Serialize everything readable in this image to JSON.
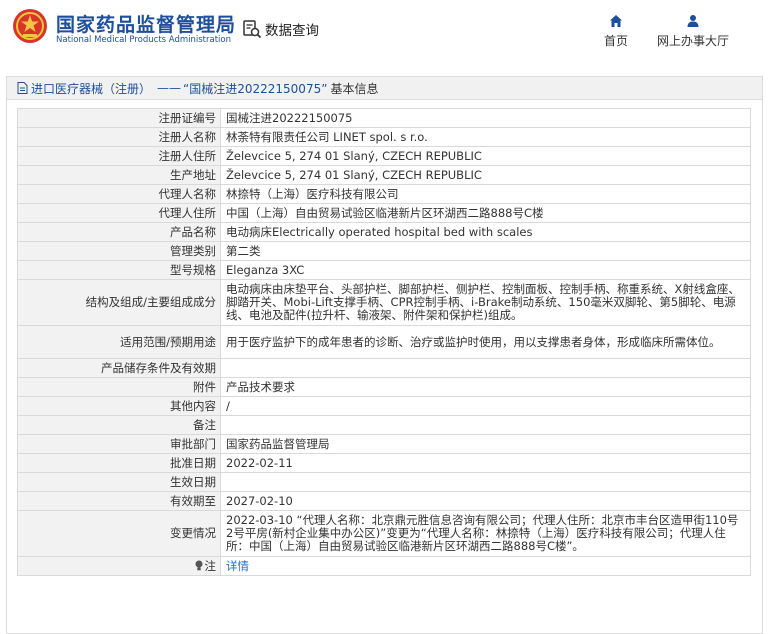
{
  "header": {
    "org_cn": "国家药品监督管理局",
    "org_en": "National Medical Products Administration",
    "query_label": "数据查询",
    "nav": [
      {
        "label": "首页",
        "icon": "home-icon"
      },
      {
        "label": "网上办事大厅",
        "icon": "user-icon"
      }
    ]
  },
  "breadcrumb": {
    "part1": "进口医疗器械（注册）",
    "sep": "——",
    "part2": "“国械注进20222150075”",
    "part3": "基本信息"
  },
  "rows": [
    {
      "label": "注册证编号",
      "value": "国械注进20222150075"
    },
    {
      "label": "注册人名称",
      "value": "林荼特有限责任公司 LINET spol. s r.o."
    },
    {
      "label": "注册人住所",
      "value": "Želevcice 5, 274 01 Slaný, CZECH REPUBLIC"
    },
    {
      "label": "生产地址",
      "value": "Želevcice 5, 274 01 Slaný, CZECH REPUBLIC"
    },
    {
      "label": "代理人名称",
      "value": "林捺特（上海）医疗科技有限公司"
    },
    {
      "label": "代理人住所",
      "value": "中国（上海）自由贸易试验区临港新片区环湖西二路888号C楼"
    },
    {
      "label": "产品名称",
      "value": "电动病床Electrically operated hospital bed with scales"
    },
    {
      "label": "管理类别",
      "value": "第二类"
    },
    {
      "label": "型号规格",
      "value": "Eleganza 3XC"
    },
    {
      "label": "结构及组成/主要组成成分",
      "value": "电动病床由床垫平台、头部护栏、脚部护栏、侧护栏、控制面板、控制手柄、称重系统、X射线盒座、脚踏开关、Mobi-Lift支撑手柄、CPR控制手柄、i-Brake制动系统、150毫米双脚轮、第5脚轮、电源线、电池及配件(拉升杆、输液架、附件架和保护栏)组成。"
    },
    {
      "label": "适用范围/预期用途",
      "value": "用于医疗监护下的成年患者的诊断、治疗或监护时使用，用以支撑患者身体，形成临床所需体位。"
    },
    {
      "label": "产品储存条件及有效期",
      "value": ""
    },
    {
      "label": "附件",
      "value": "产品技术要求"
    },
    {
      "label": "其他内容",
      "value": "/"
    },
    {
      "label": "备注",
      "value": ""
    },
    {
      "label": "审批部门",
      "value": "国家药品监督管理局"
    },
    {
      "label": "批准日期",
      "value": "2022-02-11"
    },
    {
      "label": "生效日期",
      "value": ""
    },
    {
      "label": "有效期至",
      "value": "2027-02-10"
    },
    {
      "label": "变更情况",
      "value": "2022-03-10 “代理人名称：北京鼎元胜信息咨询有限公司；代理人住所：北京市丰台区造甲街110号2号平房(新村企业集中办公区)”变更为“代理人名称：林捺特（上海）医疗科技有限公司；代理人住所：中国（上海）自由贸易试验区临港新片区环湖西二路888号C楼”。"
    },
    {
      "label": "注",
      "value": "详情"
    }
  ],
  "row_heights": [
    19,
    19,
    19,
    19,
    19,
    19,
    19,
    19,
    19,
    46,
    33,
    19,
    19,
    19,
    19,
    19,
    19,
    19,
    19,
    46,
    19
  ],
  "colors": {
    "brand_blue": "#1d4f9c",
    "link_blue": "#1d6fcf",
    "label_bg": "#f2f2f2",
    "border": "#d9d9d9"
  }
}
